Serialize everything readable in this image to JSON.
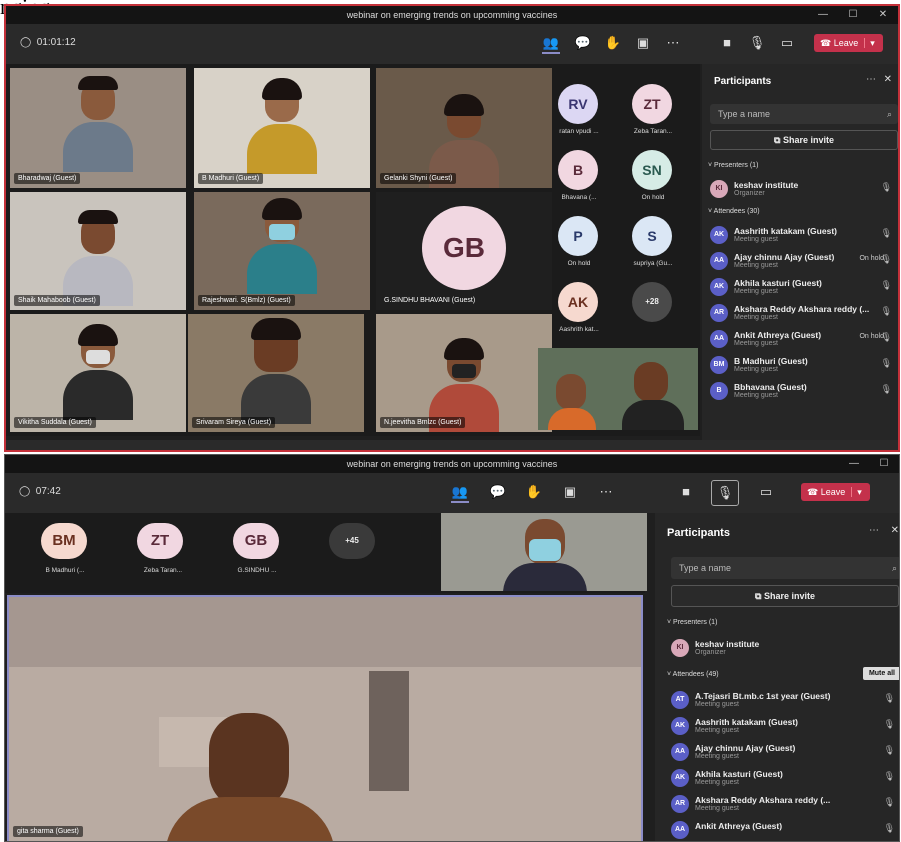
{
  "caption": "nging",
  "s1": {
    "title": "webinar on emerging trends on upcomming vaccines",
    "timer": "01:01:12",
    "leave_label": "Leave",
    "tiles": [
      {
        "name": "Bharadwaj (Guest)",
        "shirt": "#6c7a8a"
      },
      {
        "name": "B Madhuri (Guest)",
        "shirt": "#c59a2a"
      },
      {
        "name": "Gelanki Shyni (Guest)",
        "shirt": "#7b5a4a"
      },
      {
        "name": "Shaik Mahaboob (Guest)",
        "shirt": "#b8b8c0"
      },
      {
        "name": "Rajeshwari. S(Bmlz) (Guest)",
        "shirt": "#2b7f8a"
      },
      {
        "name": "G.SINDHU BHAVANI (Guest)"
      },
      {
        "name": "Vikitha Suddala (Guest)",
        "shirt": "#2a2a2a"
      },
      {
        "name": "Srivaram Sireya (Guest)",
        "shirt": "#3a3a3a"
      },
      {
        "name": "N.jeevitha Bmlzc (Guest)",
        "shirt": "#b04a3a"
      }
    ],
    "big_avatar": "GB",
    "avatars": [
      {
        "initials": "RV",
        "label": "ratan vpudi ..."
      },
      {
        "initials": "ZT",
        "label": "Zeba Taran..."
      },
      {
        "initials": "B",
        "label": "Bhavana (..."
      },
      {
        "initials": "SN",
        "label": "On hold"
      },
      {
        "initials": "P",
        "label": "On hold"
      },
      {
        "initials": "S",
        "label": "supriya (Gu..."
      },
      {
        "initials": "AK",
        "label": "Aashrith kat..."
      },
      {
        "initials": "+28",
        "label": ""
      }
    ],
    "panel": {
      "title": "Participants",
      "search_placeholder": "Type a name",
      "invite": "Share invite",
      "presenters": "Presenters (1)",
      "presenter": {
        "initials": "KI",
        "name": "keshav institute",
        "sub": "Organizer"
      },
      "attendees": "Attendees (30)",
      "rows": [
        {
          "initials": "AK",
          "name": "Aashrith katakam (Guest)",
          "sub": "Meeting guest",
          "state": ""
        },
        {
          "initials": "AA",
          "name": "Ajay chinnu Ajay (Guest)",
          "sub": "Meeting guest",
          "state": "On hold"
        },
        {
          "initials": "AK",
          "name": "Akhila kasturi (Guest)",
          "sub": "Meeting guest",
          "state": ""
        },
        {
          "initials": "AR",
          "name": "Akshara Reddy Akshara reddy (...",
          "sub": "Meeting guest",
          "state": ""
        },
        {
          "initials": "AA",
          "name": "Ankit Athreya (Guest)",
          "sub": "Meeting guest",
          "state": "On hold"
        },
        {
          "initials": "BM",
          "name": "B Madhuri (Guest)",
          "sub": "Meeting guest",
          "state": ""
        },
        {
          "initials": "B",
          "name": "Bbhavana (Guest)",
          "sub": "Meeting guest",
          "state": ""
        }
      ]
    }
  },
  "s2": {
    "title": "webinar on emerging trends on upcomming vaccines",
    "timer": "07:42",
    "leave_label": "Leave",
    "avatars": [
      {
        "initials": "BM",
        "label": "B Madhuri (..."
      },
      {
        "initials": "ZT",
        "label": "Zeba Taran..."
      },
      {
        "initials": "GB",
        "label": "G.SINDHU ..."
      },
      {
        "initials": "+45",
        "label": ""
      }
    ],
    "speaker_name": "gita sharma (Guest)",
    "panel": {
      "title": "Participants",
      "search_placeholder": "Type a name",
      "invite": "Share invite",
      "presenters": "Presenters (1)",
      "presenter": {
        "initials": "KI",
        "name": "keshav institute",
        "sub": "Organizer"
      },
      "attendees": "Attendees (49)",
      "mute_all": "Mute all",
      "rows": [
        {
          "initials": "AT",
          "name": "A.Tejasri Bt.mb.c 1st year (Guest)",
          "sub": "Meeting guest"
        },
        {
          "initials": "AK",
          "name": "Aashrith katakam (Guest)",
          "sub": "Meeting guest"
        },
        {
          "initials": "AA",
          "name": "Ajay chinnu Ajay (Guest)",
          "sub": "Meeting guest"
        },
        {
          "initials": "AK",
          "name": "Akhila kasturi (Guest)",
          "sub": "Meeting guest"
        },
        {
          "initials": "AR",
          "name": "Akshara Reddy Akshara reddy (...",
          "sub": "Meeting guest"
        },
        {
          "initials": "AA",
          "name": "Ankit Athreya (Guest)",
          "sub": ""
        }
      ]
    }
  }
}
